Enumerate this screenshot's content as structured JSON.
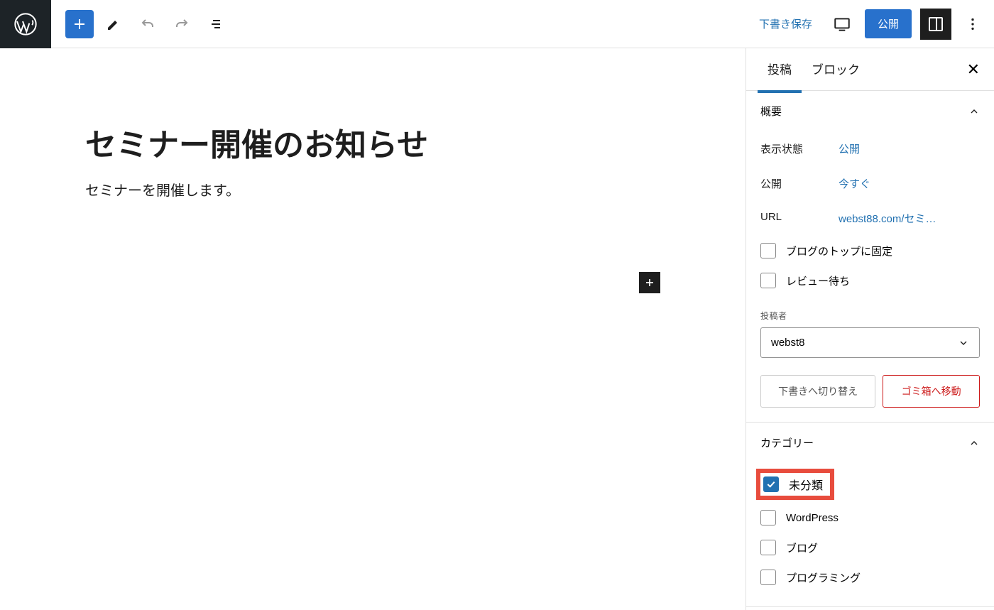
{
  "toolbar": {
    "save_draft": "下書き保存",
    "publish": "公開"
  },
  "editor": {
    "title": "セミナー開催のお知らせ",
    "body": "セミナーを開催します。"
  },
  "sidebar": {
    "tabs": {
      "post": "投稿",
      "block": "ブロック"
    },
    "summary": {
      "header": "概要",
      "visibility_label": "表示状態",
      "visibility_value": "公開",
      "publish_label": "公開",
      "publish_value": "今すぐ",
      "url_label": "URL",
      "url_value": "webst88.com/セミ…",
      "sticky": "ブログのトップに固定",
      "pending": "レビュー待ち",
      "author_label": "投稿者",
      "author_value": "webst8",
      "switch_draft": "下書きへ切り替え",
      "trash": "ゴミ箱へ移動"
    },
    "categories": {
      "header": "カテゴリー",
      "items": [
        "未分類",
        "WordPress",
        "ブログ",
        "プログラミング"
      ]
    }
  }
}
